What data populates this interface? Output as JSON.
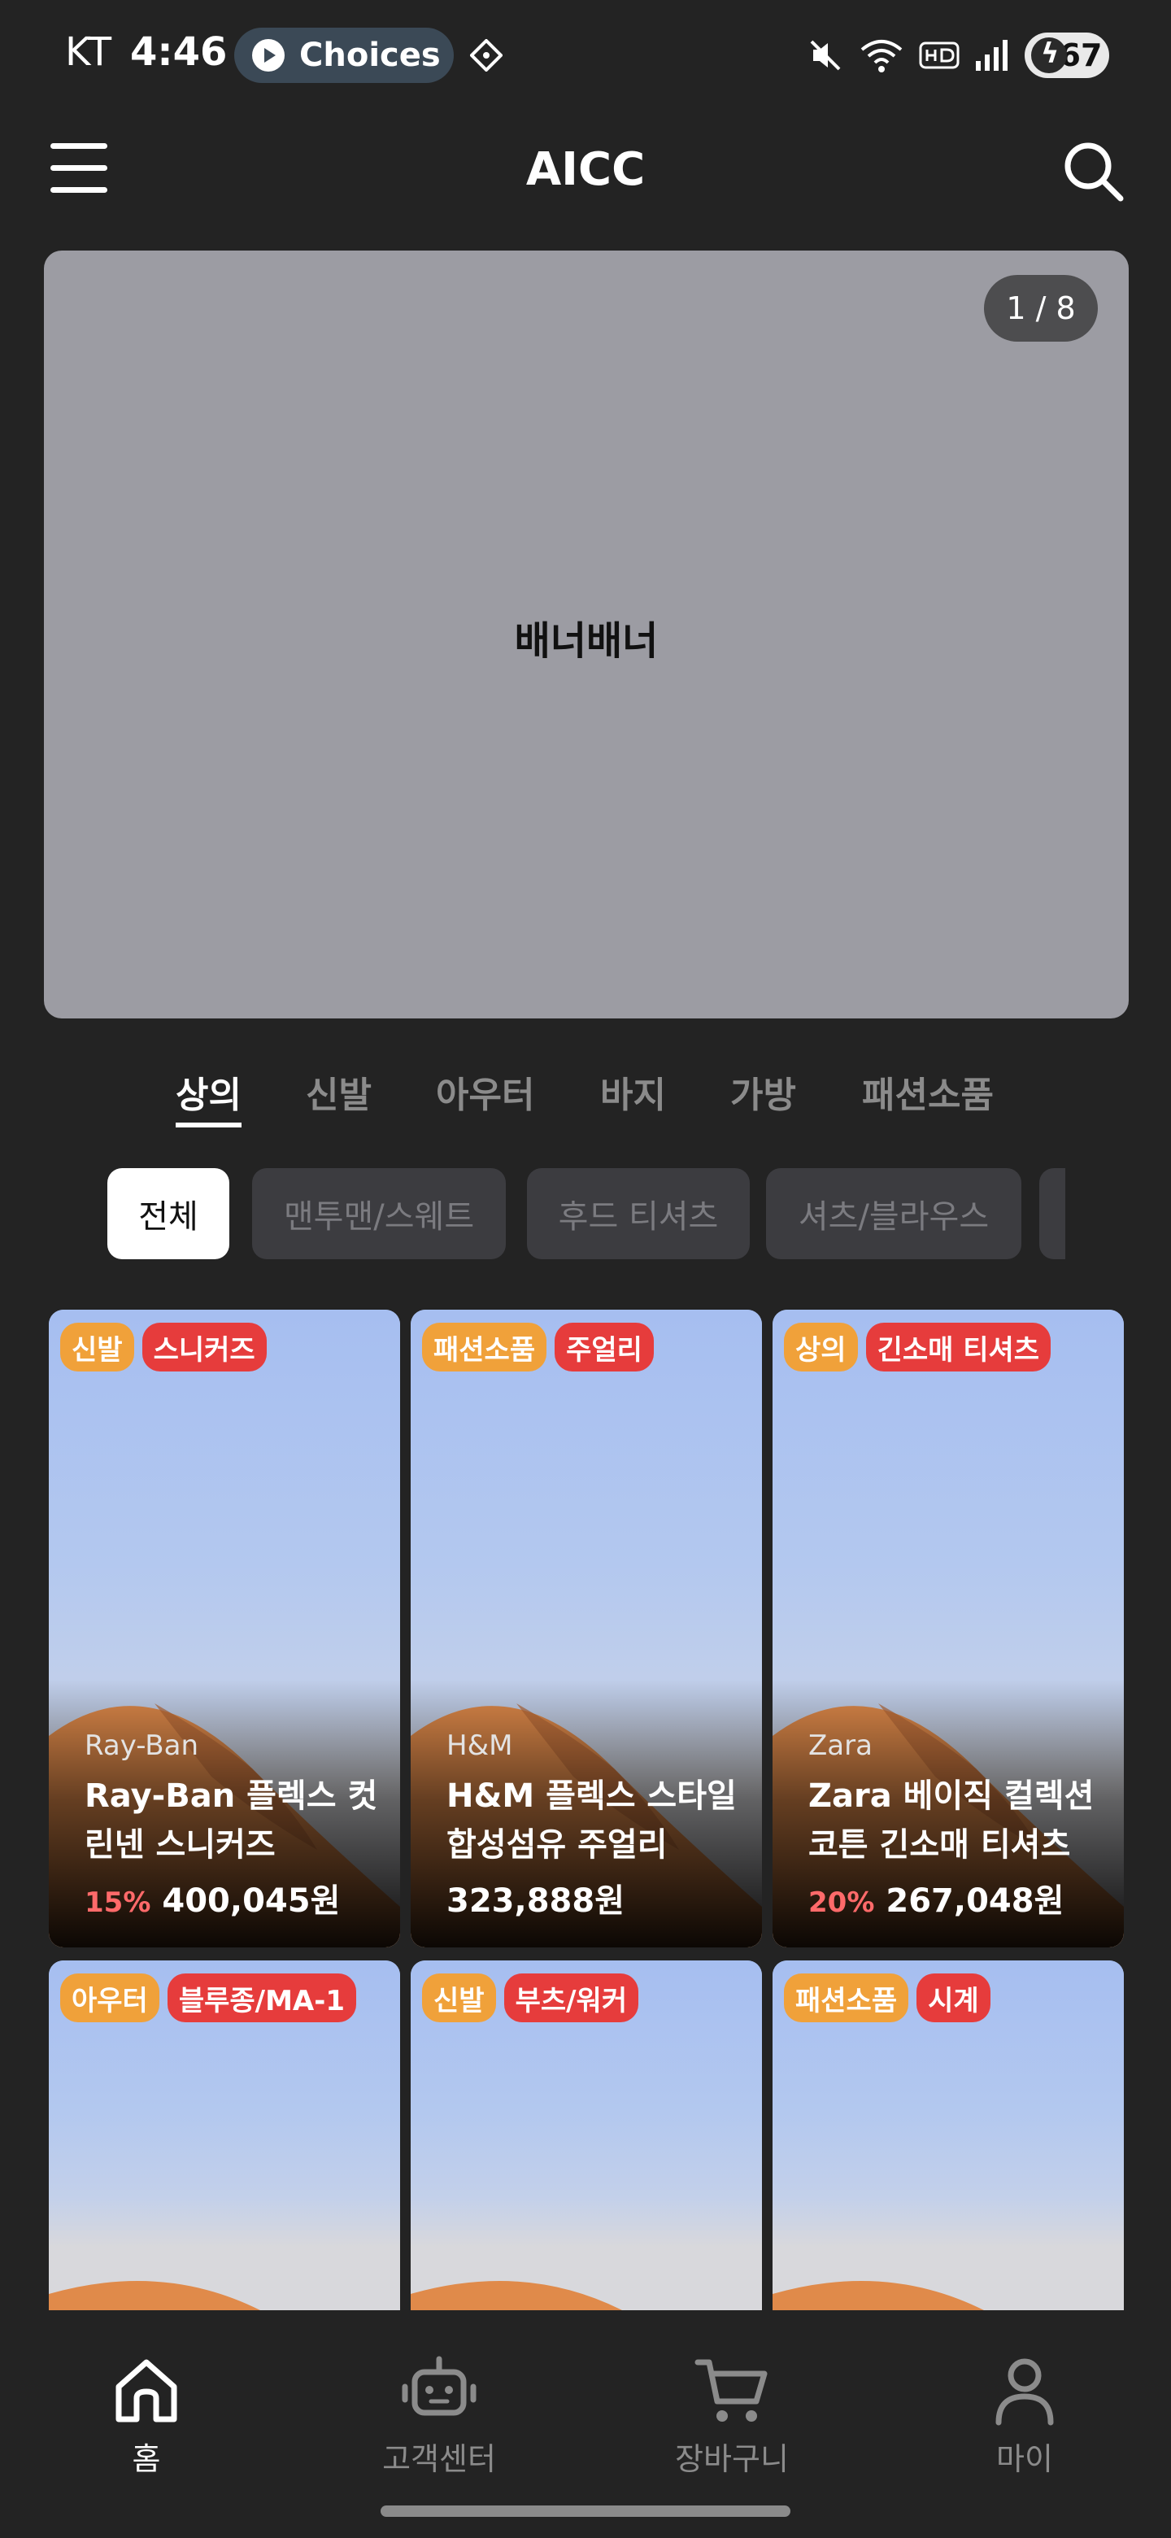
{
  "status_bar": {
    "carrier": "KT",
    "time": "4:46",
    "app_pill": "Choices",
    "battery": "67"
  },
  "header": {
    "title": "AICC"
  },
  "banner": {
    "text": "배너배너",
    "counter": "1 / 8"
  },
  "category_tabs": [
    "상의",
    "신발",
    "아우터",
    "바지",
    "가방",
    "패션소품"
  ],
  "sub_chips": [
    "전체",
    "맨투맨/스웨트",
    "후드 티셔츠",
    "셔츠/블라우스"
  ],
  "products": [
    {
      "category": "신발",
      "subcategory": "스니커즈",
      "brand": "Ray-Ban",
      "name_line1": "Ray-Ban 플렉스 컷",
      "name_line2": "린넨 스니커즈",
      "discount": "15%",
      "price": "400,045원"
    },
    {
      "category": "패션소품",
      "subcategory": "주얼리",
      "brand": "H&M",
      "name_line1": "H&M 플렉스 스타일",
      "name_line2": "합성섬유 주얼리",
      "discount": "",
      "price": "323,888원"
    },
    {
      "category": "상의",
      "subcategory": "긴소매 티셔츠",
      "brand": "Zara",
      "name_line1": "Zara 베이직 컬렉션",
      "name_line2": "코튼 긴소매 티셔츠",
      "discount": "20%",
      "price": "267,048원"
    },
    {
      "category": "아우터",
      "subcategory": "블루종/MA-1"
    },
    {
      "category": "신발",
      "subcategory": "부츠/워커"
    },
    {
      "category": "패션소품",
      "subcategory": "시계"
    }
  ],
  "bottom_nav": [
    "홈",
    "고객센터",
    "장바구니",
    "마이"
  ],
  "colors": {
    "background": "#232323",
    "banner": "#9c9ca3",
    "category_badge": "#f0a13a",
    "subcategory_badge": "#e63c3c",
    "discount": "#ff6a6a"
  }
}
